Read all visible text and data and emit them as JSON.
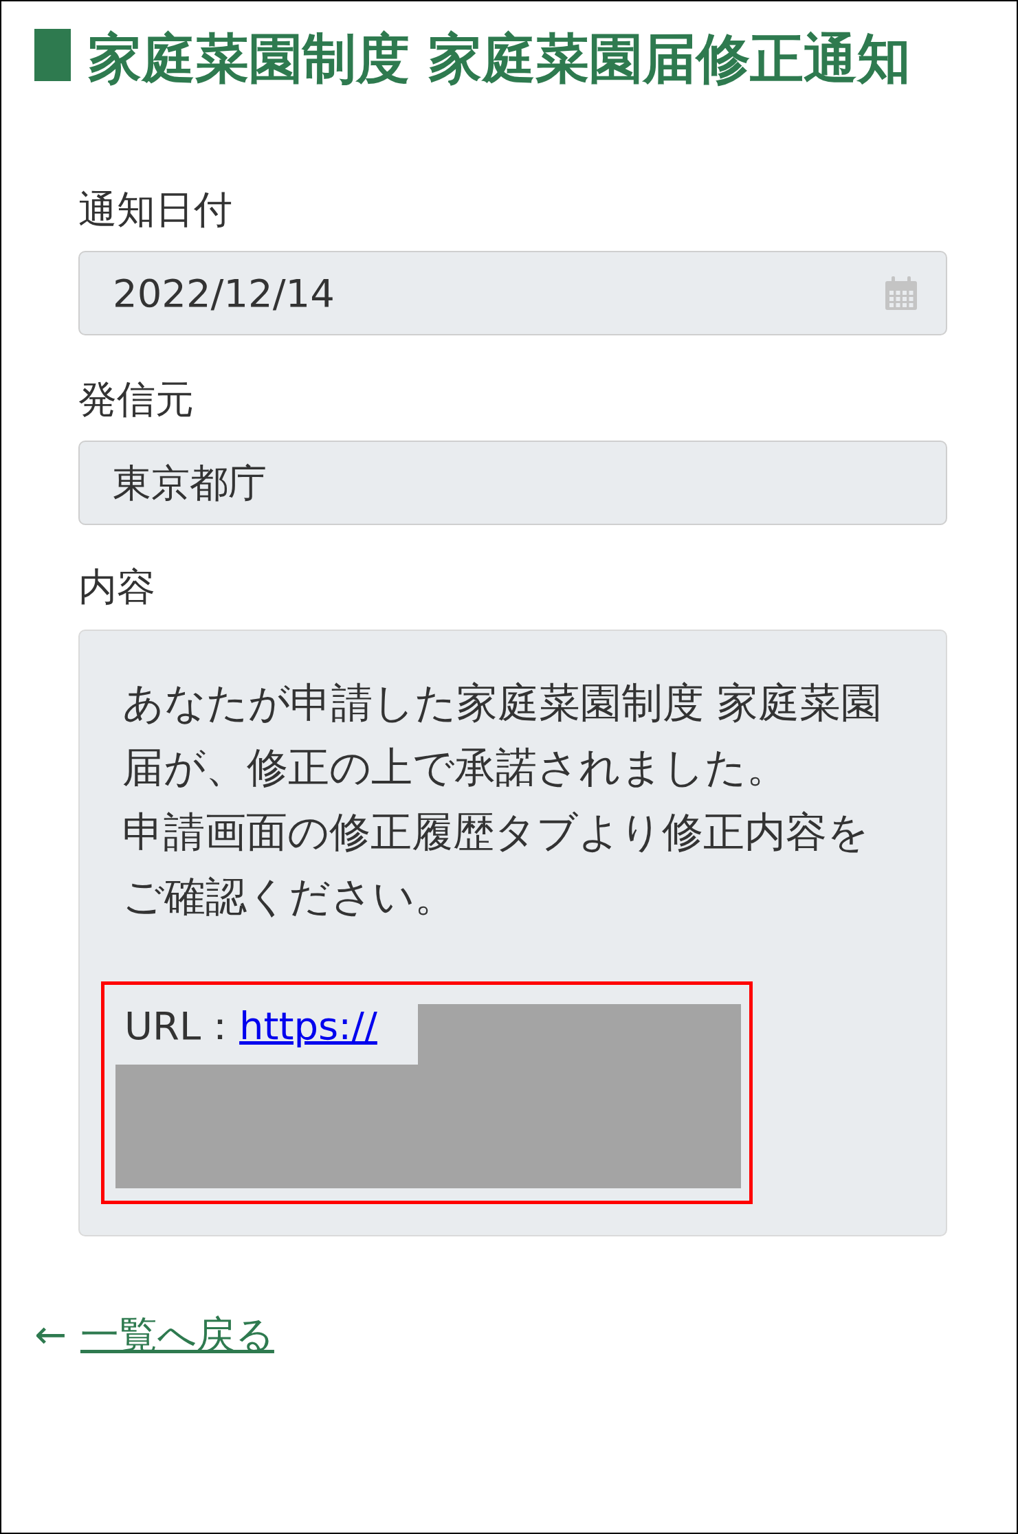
{
  "title": "家庭菜園制度 家庭菜園届修正通知",
  "fields": [
    {
      "label": "通知日付",
      "value": "2022/12/14",
      "kind": "date"
    },
    {
      "label": "発信元",
      "value": "東京都庁",
      "kind": "text"
    }
  ],
  "content": {
    "label": "内容",
    "paragraphs": [
      "あなたが申請した家庭菜園制度 家庭菜園届が、修正の上で承諾されました。",
      "申請画面の修正履歴タブより修正内容をご確認ください。"
    ],
    "url_label": "URL：",
    "url_link": "https://"
  },
  "back_link": {
    "arrow": "←",
    "label": "一覧へ戻る"
  }
}
